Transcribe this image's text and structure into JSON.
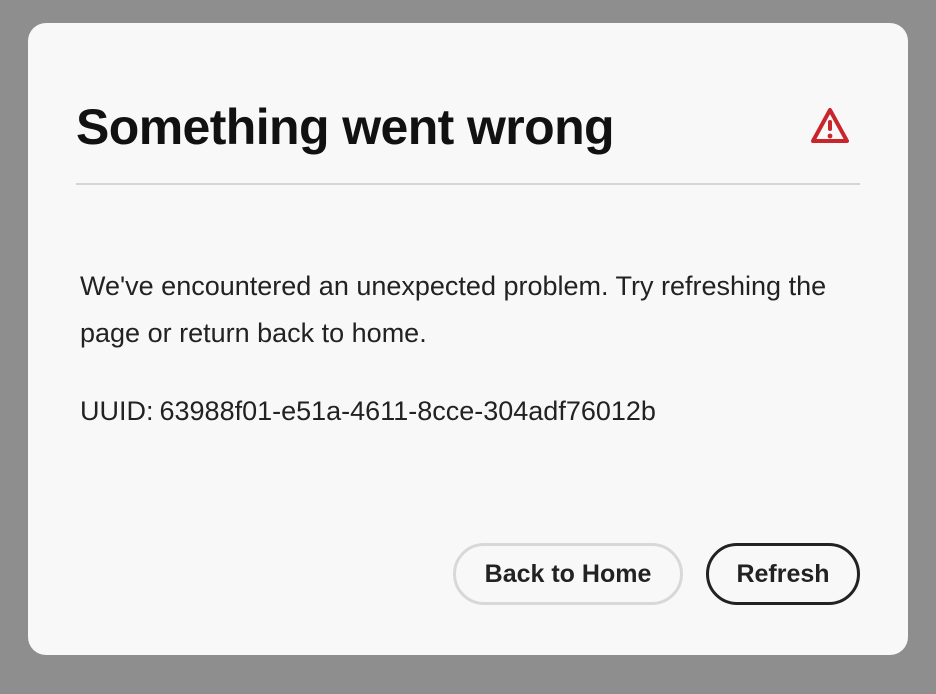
{
  "dialog": {
    "title": "Something went wrong",
    "icon": "alert-triangle-icon",
    "icon_color": "#c9252d",
    "message": "We've encountered an unexpected problem. Try refreshing the page or return back to home.",
    "uuid_label": "UUID:",
    "uuid_value": "63988f01-e51a-4611-8cce-304adf76012b",
    "buttons": {
      "back_home": "Back to Home",
      "refresh": "Refresh"
    }
  }
}
